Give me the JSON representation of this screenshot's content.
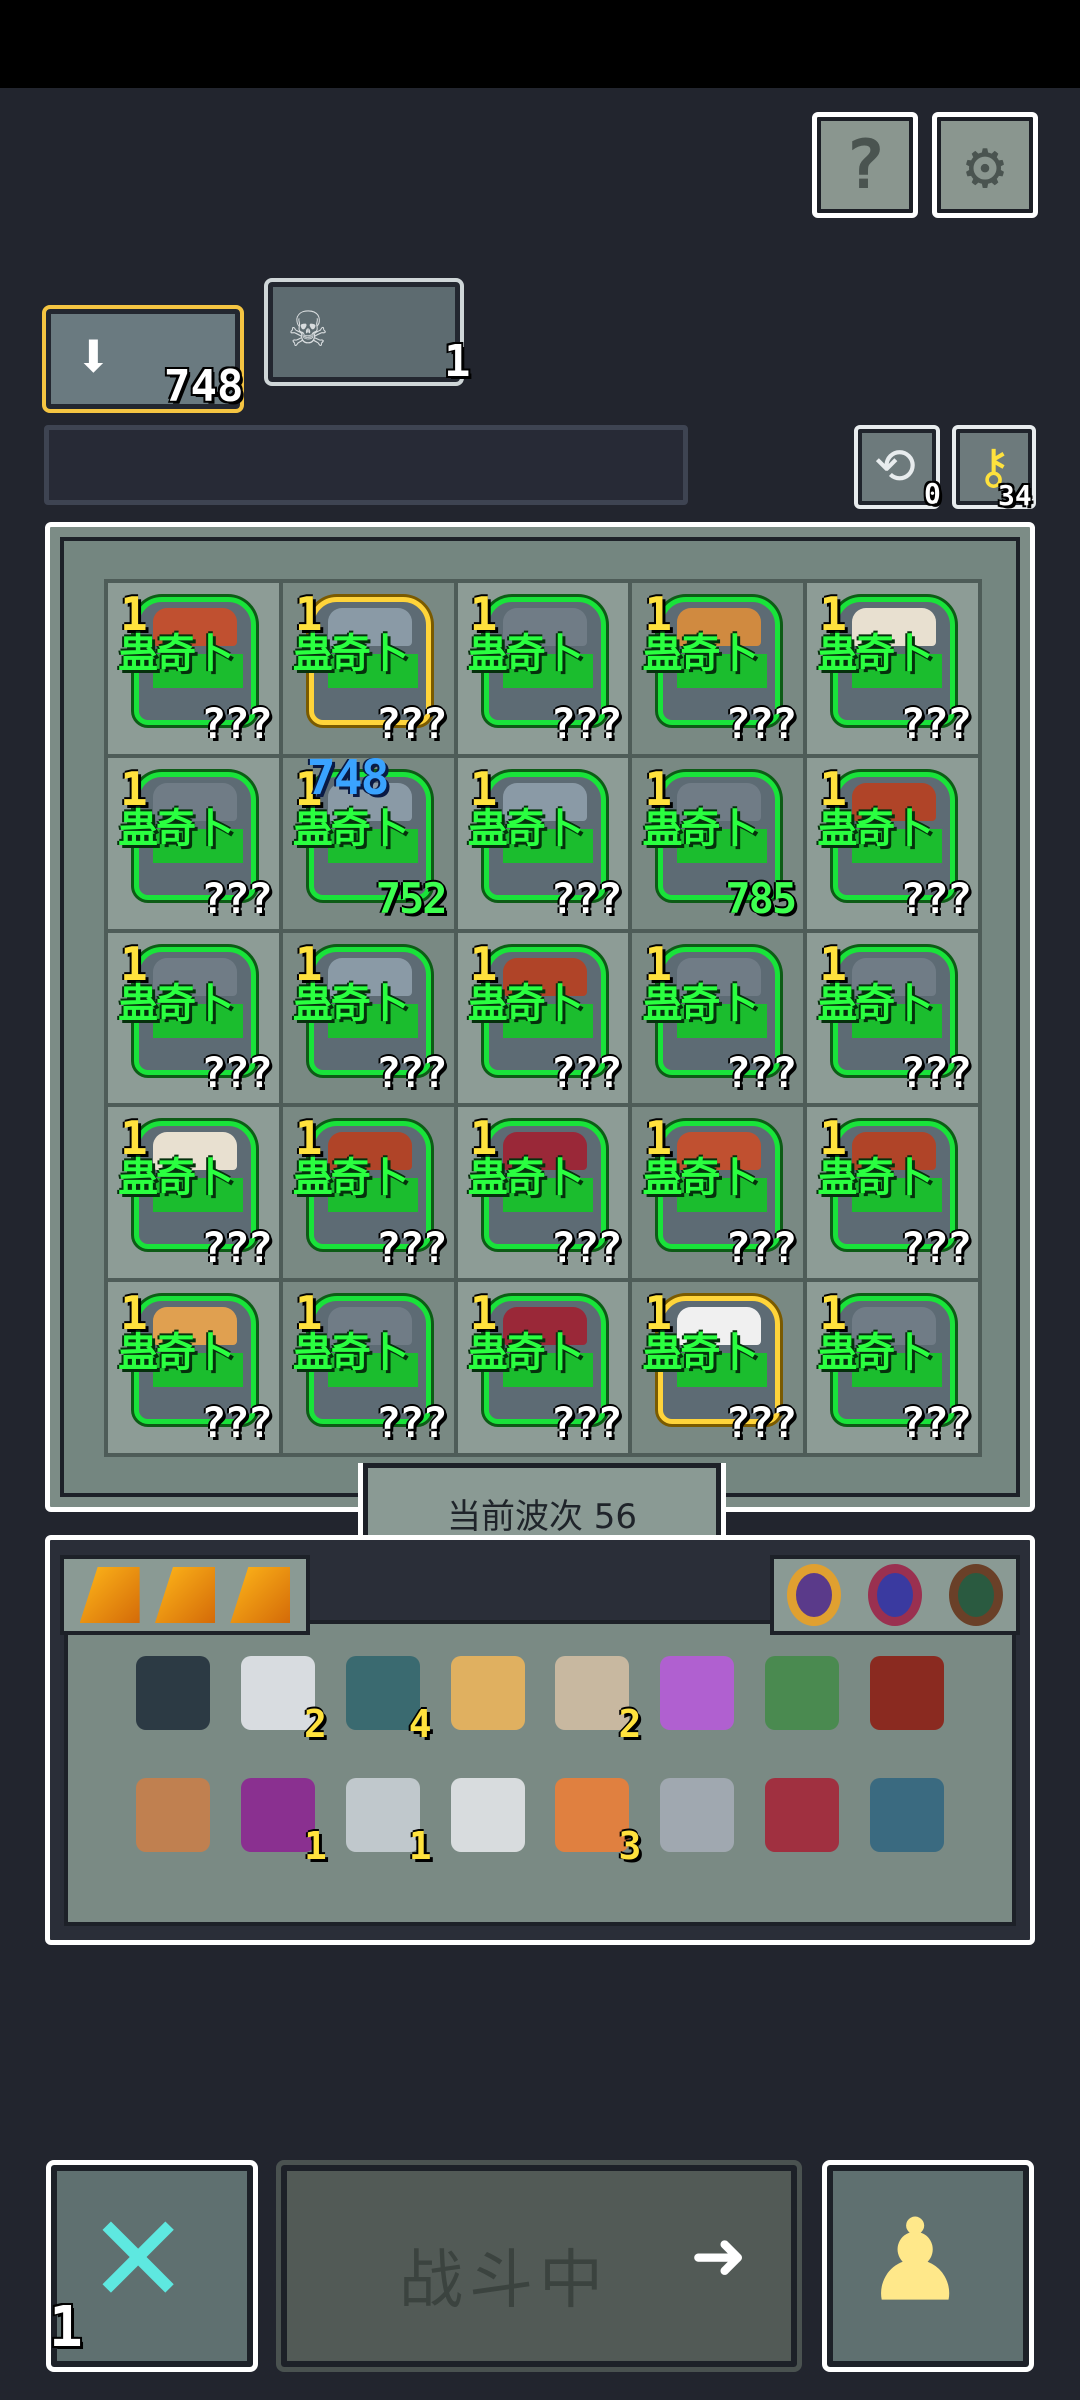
{
  "header": {
    "help_icon": "question-mark-icon",
    "settings_icon": "gear-icon"
  },
  "resources": {
    "primary_count": "748",
    "secondary_count": "1",
    "reroll_count": "0",
    "key_count": "34"
  },
  "board": {
    "cells": [
      {
        "level": "1",
        "name": "蛊奇卜",
        "hp": "???",
        "helmet": "#c05030",
        "gold": false
      },
      {
        "level": "1",
        "name": "蛊奇卜",
        "hp": "???",
        "helmet": "#8a9aa6",
        "gold": true
      },
      {
        "level": "1",
        "name": "蛊奇卜",
        "hp": "???",
        "helmet": "#707c86",
        "gold": false
      },
      {
        "level": "1",
        "name": "蛊奇卜",
        "hp": "???",
        "helmet": "#d08a40",
        "gold": false
      },
      {
        "level": "1",
        "name": "蛊奇卜",
        "hp": "???",
        "helmet": "#e8e0d0",
        "gold": false
      },
      {
        "level": "1",
        "name": "蛊奇卜",
        "hp": "???",
        "helmet": "#707c86",
        "gold": false
      },
      {
        "level": "1",
        "name": "蛊奇卜",
        "hp": "752",
        "helmet": "#8a9aa6",
        "gold": false,
        "hp_green": true,
        "float": "748"
      },
      {
        "level": "1",
        "name": "蛊奇卜",
        "hp": "???",
        "helmet": "#8a9aa6",
        "gold": false
      },
      {
        "level": "1",
        "name": "蛊奇卜",
        "hp": "785",
        "helmet": "#707c86",
        "gold": false,
        "hp_green": true
      },
      {
        "level": "1",
        "name": "蛊奇卜",
        "hp": "???",
        "helmet": "#b04428",
        "gold": false
      },
      {
        "level": "1",
        "name": "蛊奇卜",
        "hp": "???",
        "helmet": "#707c86",
        "gold": false
      },
      {
        "level": "1",
        "name": "蛊奇卜",
        "hp": "???",
        "helmet": "#8a9aa6",
        "gold": false
      },
      {
        "level": "1",
        "name": "蛊奇卜",
        "hp": "???",
        "helmet": "#b04428",
        "gold": false
      },
      {
        "level": "1",
        "name": "蛊奇卜",
        "hp": "???",
        "helmet": "#707c86",
        "gold": false
      },
      {
        "level": "1",
        "name": "蛊奇卜",
        "hp": "???",
        "helmet": "#707c86",
        "gold": false
      },
      {
        "level": "1",
        "name": "蛊奇卜",
        "hp": "???",
        "helmet": "#e8e0d0",
        "gold": false
      },
      {
        "level": "1",
        "name": "蛊奇卜",
        "hp": "???",
        "helmet": "#b04428",
        "gold": false
      },
      {
        "level": "1",
        "name": "蛊奇卜",
        "hp": "???",
        "helmet": "#9a2838",
        "gold": false
      },
      {
        "level": "1",
        "name": "蛊奇卜",
        "hp": "???",
        "helmet": "#c05030",
        "gold": false
      },
      {
        "level": "1",
        "name": "蛊奇卜",
        "hp": "???",
        "helmet": "#b04428",
        "gold": false
      },
      {
        "level": "1",
        "name": "蛊奇卜",
        "hp": "???",
        "helmet": "#e0a050",
        "gold": false
      },
      {
        "level": "1",
        "name": "蛊奇卜",
        "hp": "???",
        "helmet": "#707c86",
        "gold": false
      },
      {
        "level": "1",
        "name": "蛊奇卜",
        "hp": "???",
        "helmet": "#9a2838",
        "gold": false
      },
      {
        "level": "1",
        "name": "蛊奇卜",
        "hp": "???",
        "helmet": "#f0f0f0",
        "gold": true
      },
      {
        "level": "1",
        "name": "蛊奇卜",
        "hp": "???",
        "helmet": "#707c86",
        "gold": false
      }
    ]
  },
  "wave": {
    "label": "当前波次 56"
  },
  "inventory": {
    "row1": [
      {
        "icon": "chip-icon",
        "color": "#2c3a44",
        "count": ""
      },
      {
        "icon": "scroll-icon",
        "color": "#d8dce0",
        "count": "2"
      },
      {
        "icon": "heart-gem-icon",
        "color": "#3a6a70",
        "count": "4"
      },
      {
        "icon": "trident-icon",
        "color": "#e0b060",
        "count": ""
      },
      {
        "icon": "map-icon",
        "color": "#c8b8a0",
        "count": "2"
      },
      {
        "icon": "wand-icon",
        "color": "#b060d0",
        "count": ""
      },
      {
        "icon": "grass-icon",
        "color": "#4a8a50",
        "count": ""
      },
      {
        "icon": "orb-icon",
        "color": "#8a2a20",
        "count": ""
      }
    ],
    "row2": [
      {
        "icon": "feather-icon",
        "color": "#c08050",
        "count": ""
      },
      {
        "icon": "demon-mask-icon",
        "color": "#8a3090",
        "count": "1"
      },
      {
        "icon": "skull-icon",
        "color": "#c0c8cc",
        "count": "1"
      },
      {
        "icon": "scythe-icon",
        "color": "#d8dcde",
        "count": ""
      },
      {
        "icon": "claw-icon",
        "color": "#e08040",
        "count": "3"
      },
      {
        "icon": "chest-icon",
        "color": "#a0a8b0",
        "count": ""
      },
      {
        "icon": "banner-icon",
        "color": "#a03040",
        "count": ""
      },
      {
        "icon": "wing-icon",
        "color": "#3a6a80",
        "count": ""
      }
    ]
  },
  "bottom": {
    "cancel_count": "1",
    "fight_label": "战斗中"
  }
}
